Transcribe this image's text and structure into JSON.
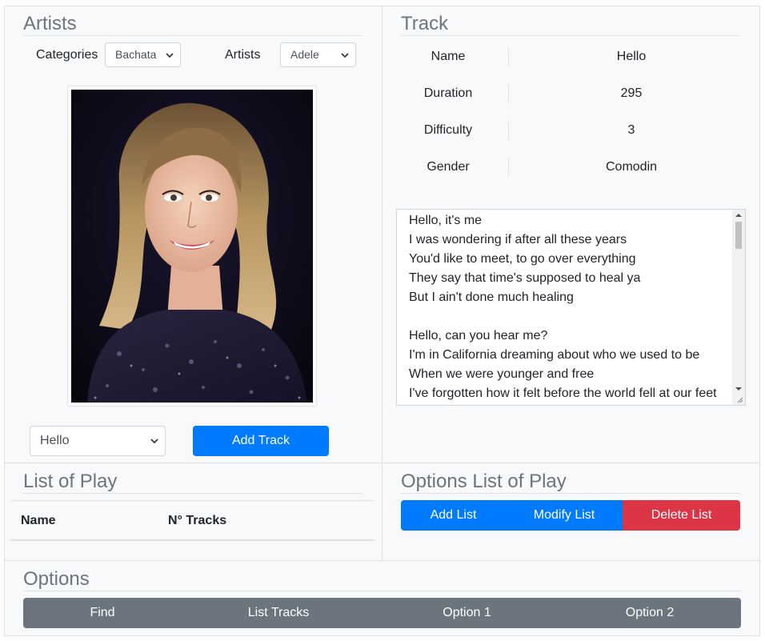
{
  "artists": {
    "title": "Artists",
    "categories_label": "Categories",
    "categories_value": "Bachata",
    "artists_label": "Artists",
    "artists_value": "Adele",
    "track_select_value": "Hello",
    "add_track_label": "Add Track"
  },
  "track": {
    "title": "Track",
    "rows": [
      {
        "key": "Name",
        "value": "Hello"
      },
      {
        "key": "Duration",
        "value": "295"
      },
      {
        "key": "Difficulty",
        "value": "3"
      },
      {
        "key": "Gender",
        "value": "Comodin"
      }
    ],
    "lyrics": "Hello, it's me\nI was wondering if after all these years\nYou'd like to meet, to go over everything\nThey say that time's supposed to heal ya\nBut I ain't done much healing\n\nHello, can you hear me?\nI'm in California dreaming about who we used to be\nWhen we were younger and free\nI've forgotten how it felt before the world fell at our feet"
  },
  "playlist": {
    "title": "List of Play",
    "col_name": "Name",
    "col_tracks": "N° Tracks"
  },
  "playlist_options": {
    "title": "Options List of Play",
    "add": "Add List",
    "modify": "Modify List",
    "delete": "Delete List"
  },
  "options": {
    "title": "Options",
    "find": "Find",
    "list_tracks": "List Tracks",
    "option1": "Option 1",
    "option2": "Option 2"
  },
  "colors": {
    "primary": "#007bff",
    "danger": "#dc3545",
    "secondary": "#6c757d",
    "panel_bg": "#f8f9fa"
  },
  "icons": {
    "select_caret": "chevron-down-icon",
    "photo": "artist-photo"
  }
}
